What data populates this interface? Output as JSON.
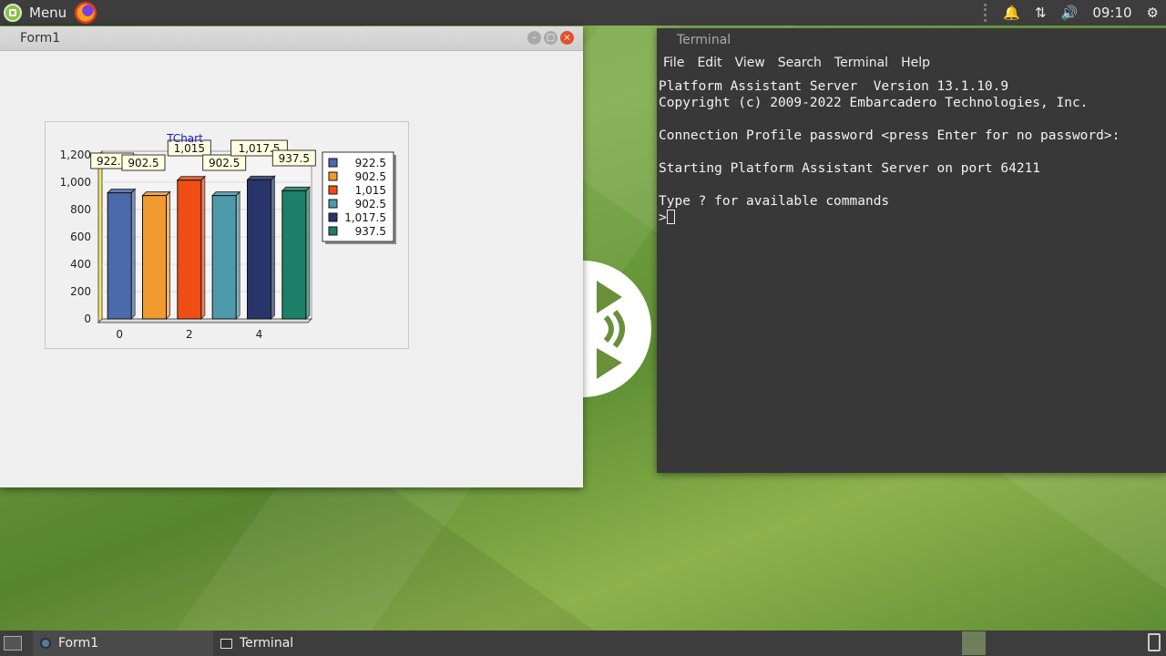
{
  "topbar": {
    "menu_label": "Menu",
    "clock": "09:10"
  },
  "form1": {
    "title": "Form1"
  },
  "terminal": {
    "title": "Terminal",
    "menu": [
      "File",
      "Edit",
      "View",
      "Search",
      "Terminal",
      "Help"
    ],
    "lines": [
      "Platform Assistant Server  Version 13.1.10.9",
      "Copyright (c) 2009-2022 Embarcadero Technologies, Inc.",
      "",
      "Connection Profile password <press Enter for no password>:",
      "",
      "Starting Platform Assistant Server on port 64211",
      "",
      "Type ? for available commands"
    ],
    "prompt": ">"
  },
  "taskbar": {
    "form1_label": "Form1",
    "terminal_label": "Terminal"
  },
  "chart_data": {
    "type": "bar",
    "title": "TChart",
    "x": [
      0,
      1,
      2,
      3,
      4,
      5
    ],
    "values": [
      922.5,
      902.5,
      1015,
      902.5,
      1017.5,
      937.5
    ],
    "marks": [
      "922.5",
      "902.5",
      "1,015",
      "902.5",
      "1,017.5",
      "937.5"
    ],
    "colors": [
      "#4a6aab",
      "#f09a30",
      "#f04e14",
      "#4e9aaa",
      "#27356a",
      "#1d7f68"
    ],
    "x_ticks": [
      "0",
      "2",
      "4"
    ],
    "y_ticks": [
      "0",
      "200",
      "400",
      "600",
      "800",
      "1,000",
      "1,200"
    ],
    "ylim": [
      0,
      1200
    ],
    "legend": [
      "922.5",
      "902.5",
      "1,015",
      "902.5",
      "1,017.5",
      "937.5"
    ],
    "legend_position": "right",
    "grid": true
  }
}
